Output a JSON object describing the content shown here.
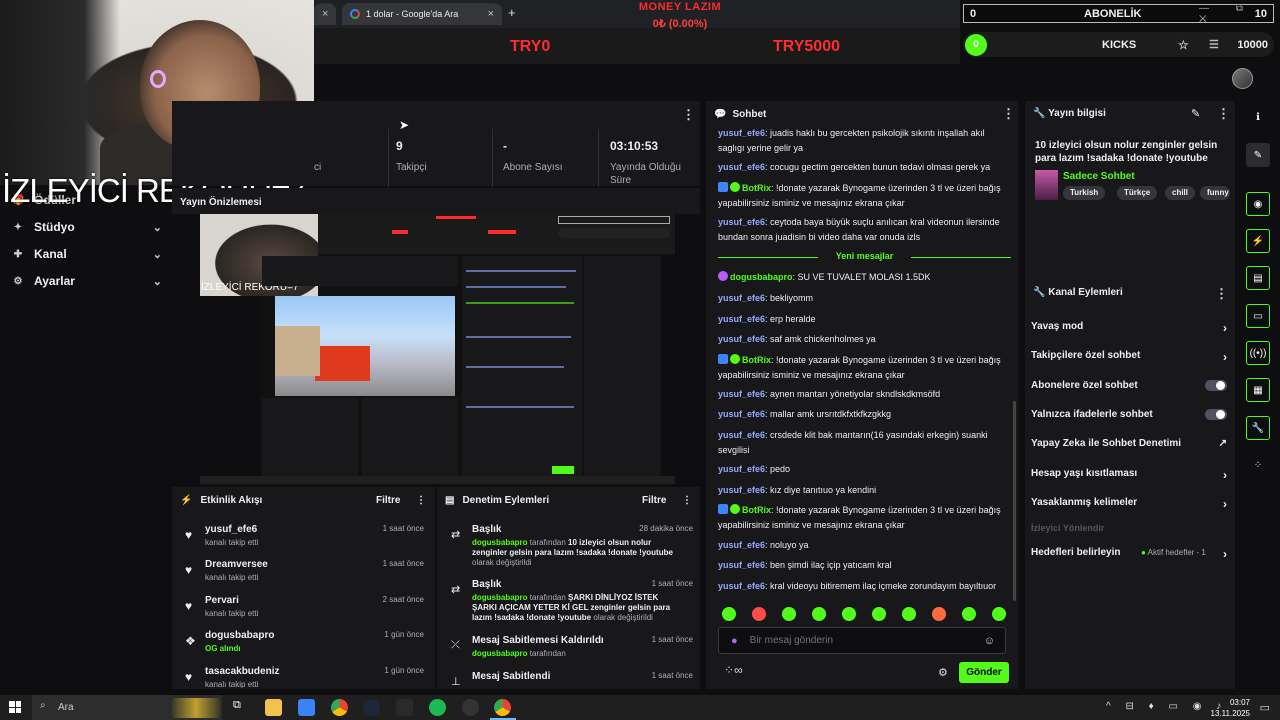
{
  "browser": {
    "tab_title": "1 dolar - Google'da Ara",
    "tab_close": "×",
    "new_tab": "+"
  },
  "overlay": {
    "money_title": "MONEY LAZIM",
    "money_value": "0₺ (0.00%)",
    "goal_left": "TRY0",
    "goal_right": "TRY5000"
  },
  "abonelik": {
    "left": "0",
    "label": "ABONELİK",
    "right": "10",
    "window_controls": "— ⧉ ✕"
  },
  "kicks": {
    "left": "0",
    "label": "KICKS",
    "right": "10000",
    "star": "☆",
    "cart": "☰"
  },
  "webcam": {
    "record_text": "İZLEYİCİ REKORU=7"
  },
  "sidebar": {
    "items": [
      {
        "label": "Ödüller",
        "icon": "gift-icon"
      },
      {
        "label": "Stüdyo",
        "icon": "studio-icon"
      },
      {
        "label": "Kanal",
        "icon": "channel-icon"
      },
      {
        "label": "Ayarlar",
        "icon": "gear-icon"
      }
    ]
  },
  "stats": {
    "items": [
      {
        "value": "",
        "label": "ci"
      },
      {
        "value": "9",
        "label": "Takipçi"
      },
      {
        "value": "-",
        "label": "Abone Sayısı"
      },
      {
        "value": "03:10:53",
        "label": "Yayında Olduğu Süre"
      }
    ],
    "menu": "⋮"
  },
  "preview": {
    "title": "Yayın Önizlemesi",
    "nested_record": "İZLEYİCİ REKORU=7"
  },
  "activity": {
    "title": "Etkinlik Akışı",
    "filter": "Filtre",
    "menu": "⋮",
    "items": [
      {
        "name": "yusuf_efe6",
        "sub": "kanalı takip etti",
        "time": "1 saat önce",
        "icon": "heart-icon"
      },
      {
        "name": "Dreamversee",
        "sub": "kanalı takip etti",
        "time": "1 saat önce",
        "icon": "heart-icon"
      },
      {
        "name": "Pervari",
        "sub": "kanalı takip etti",
        "time": "2 saat önce",
        "icon": "heart-icon"
      },
      {
        "name": "dogusbabapro",
        "sub": "OG alındı",
        "time": "1 gün önce",
        "icon": "og-icon"
      },
      {
        "name": "tasacakbudeniz",
        "sub": "kanalı takip etti",
        "time": "1 gün önce",
        "icon": "heart-icon"
      }
    ]
  },
  "moderation": {
    "title": "Denetim Eylemleri",
    "filter": "Filtre",
    "menu": "⋮",
    "items": [
      {
        "title": "Başlık",
        "time": "28 dakika önce",
        "user": "dogusbabapro",
        "mid": " tarafından ",
        "value": "10 izleyici olsun nolur zenginler gelsin para lazım !sadaka !donate !youtube",
        "tail": " olarak değiştirildi"
      },
      {
        "title": "Başlık",
        "time": "1 saat önce",
        "user": "dogusbabapro",
        "mid": " tarafından ",
        "value": "ŞARKI DİNLİYOZ İSTEK ŞARKI AÇICAM YETER Kİ GEL zenginler gelsin para lazım !sadaka !donate !youtube",
        "tail": " olarak değiştirildi"
      },
      {
        "title": "Mesaj Sabitlemesi Kaldırıldı",
        "time": "1 saat önce",
        "user": "dogusbabapro",
        "mid": " tarafından",
        "value": "",
        "tail": ""
      },
      {
        "title": "Mesaj Sabitlendi",
        "time": "1 saat önce",
        "user": "",
        "mid": "",
        "value": "",
        "tail": ""
      }
    ]
  },
  "chat": {
    "title": "Sohbet",
    "menu": "⋮",
    "new_messages": "Yeni mesajlar",
    "messages": [
      {
        "user": "yusuf_efe6",
        "text": ": juadis haklı bu gercekten psikolojik sıkıntı inşallah akıl saglıgı yerine gelir ya"
      },
      {
        "user": "yusuf_efe6",
        "text": ": cocugu gectim gercekten bunun tedavi olması gerek ya"
      },
      {
        "user": "BotRix",
        "text": ": !donate yazarak Bynogame üzerinden 3 tl ve üzeri bağış yapabilirsiniz isminiz ve mesajınız ekrana çıkar"
      },
      {
        "user": "yusuf_efe6",
        "text": ": ceytoda baya büyük suçlu anılıcan kral videonun ilersinde bundan sonra juadisin bi video daha var onuda izls"
      },
      {
        "user": "dogusbabapro",
        "text": ": SU VE TUVALET MOLASI 1.5DK"
      },
      {
        "user": "yusuf_efe6",
        "text": ": bekliyomm"
      },
      {
        "user": "yusuf_efe6",
        "text": ": erp heralde"
      },
      {
        "user": "yusuf_efe6",
        "text": ": saf amk chickenholmes ya"
      },
      {
        "user": "BotRix",
        "text": ": !donate yazarak Bynogame üzerinden 3 tl ve üzeri bağış yapabilirsiniz isminiz ve mesajınız ekrana çıkar"
      },
      {
        "user": "yusuf_efe6",
        "text": ": aynen mantarı yönetiyolar skndlskdkmsöfd"
      },
      {
        "user": "yusuf_efe6",
        "text": ": mallar amk ursrıtdkfxtkfkzgkkg"
      },
      {
        "user": "yusuf_efe6",
        "text": ": crsdede klit bak mantarın(16 yasındaki erkegin) suanki sevgilisi"
      },
      {
        "user": "yusuf_efe6",
        "text": ": pedo"
      },
      {
        "user": "yusuf_efe6",
        "text": ": kız diye tanıtıuo ya kendini"
      },
      {
        "user": "BotRix",
        "text": ": !donate yazarak Bynogame üzerinden 3 tl ve üzeri bağış yapabilirsiniz isminiz ve mesajınız ekrana çıkar"
      },
      {
        "user": "yusuf_efe6",
        "text": ": noluyo ya"
      },
      {
        "user": "yusuf_efe6",
        "text": ": ben şimdi ilaç içip yatıcam kral"
      },
      {
        "user": "yusuf_efe6",
        "text": ": kral videoyu bitiremem ilaç içmeke zorundayım bayıltıuor"
      }
    ],
    "input_placeholder": "Bir mesaj gönderin",
    "send_label": "Gönder",
    "infinity": "∞"
  },
  "stream_info": {
    "title": "Yayın bilgisi",
    "stream_title": "10 izleyici olsun nolur zenginler gelsin para lazım !sadaka !donate !youtube",
    "category": "Sadece Sohbet",
    "tags": [
      "Turkish",
      "Türkçe",
      "chill",
      "funny"
    ]
  },
  "channel_actions": {
    "title": "Kanal Eylemleri",
    "items": [
      {
        "label": "Yavaş mod",
        "kind": "chevron"
      },
      {
        "label": "Takipçilere özel sohbet",
        "kind": "chevron"
      },
      {
        "label": "Abonelere özel sohbet",
        "kind": "toggle"
      },
      {
        "label": "Yalnızca ifadelerle sohbet",
        "kind": "toggle"
      },
      {
        "label": "Yapay Zeka ile Sohbet Denetimi",
        "kind": "external"
      },
      {
        "label": "Hesap yaşı kısıtlaması",
        "kind": "chevron"
      },
      {
        "label": "Yasaklanmış kelimeler",
        "kind": "chevron"
      },
      {
        "label": "İzleyici Yönlendir",
        "kind": "disabled"
      },
      {
        "label": "Hedefleri belirleyin",
        "kind": "chevron"
      }
    ],
    "goals_status": "Aktif hedefler - 1"
  },
  "taskbar": {
    "search": "Ara",
    "time": "03:07",
    "date": "13.11.2025"
  },
  "colors": {
    "kick_green": "#53fc18",
    "panel": "#18181b",
    "bg": "#0e0e10",
    "username_blue": "#92aafe",
    "overlay_red": "#ff2a2a"
  }
}
